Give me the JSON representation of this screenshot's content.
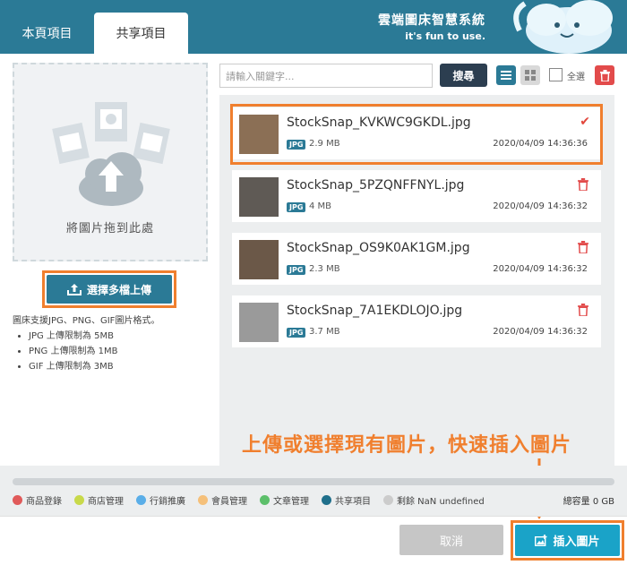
{
  "tabs": {
    "local": "本頁項目",
    "shared": "共享項目"
  },
  "brand": {
    "title": "雲端圖床智慧系統",
    "slogan": "it's fun to use."
  },
  "upload": {
    "drop_label": "將圖片拖到此處",
    "button_label": "選擇多檔上傳",
    "notes_title": "圖床支援JPG、PNG、GIF圖片格式。",
    "limits": [
      "JPG 上傳限制為 5MB",
      "PNG 上傳限制為 1MB",
      "GIF 上傳限制為 3MB"
    ]
  },
  "toolbar": {
    "search_placeholder": "請輸入關鍵字...",
    "search_button": "搜尋",
    "select_all": "全選"
  },
  "files": [
    {
      "name": "StockSnap_KVKWC9GKDL.jpg",
      "type": "JPG",
      "size": "2.9 MB",
      "time": "2020/04/09 14:36:36",
      "selected": true
    },
    {
      "name": "StockSnap_5PZQNFFNYL.jpg",
      "type": "JPG",
      "size": "4 MB",
      "time": "2020/04/09 14:36:32",
      "selected": false
    },
    {
      "name": "StockSnap_OS9K0AK1GM.jpg",
      "type": "JPG",
      "size": "2.3 MB",
      "time": "2020/04/09 14:36:32",
      "selected": false
    },
    {
      "name": "StockSnap_7A1EKDLOJO.jpg",
      "type": "JPG",
      "size": "3.7 MB",
      "time": "2020/04/09 14:36:32",
      "selected": false
    }
  ],
  "annotation": "上傳或選擇現有圖片，快速插入圖片",
  "legend": [
    {
      "label": "商品登錄",
      "color": "#e05a5a"
    },
    {
      "label": "商店管理",
      "color": "#c8d94a"
    },
    {
      "label": "行銷推廣",
      "color": "#5aaee8"
    },
    {
      "label": "會員管理",
      "color": "#f5c07a"
    },
    {
      "label": "文章管理",
      "color": "#5cbf6a"
    },
    {
      "label": "共享項目",
      "color": "#1f6f8b"
    },
    {
      "label": "剩餘 NaN undefined",
      "color": "#cccccc"
    }
  ],
  "capacity": "總容量 0 GB",
  "footer": {
    "cancel": "取消",
    "insert": "插入圖片"
  }
}
